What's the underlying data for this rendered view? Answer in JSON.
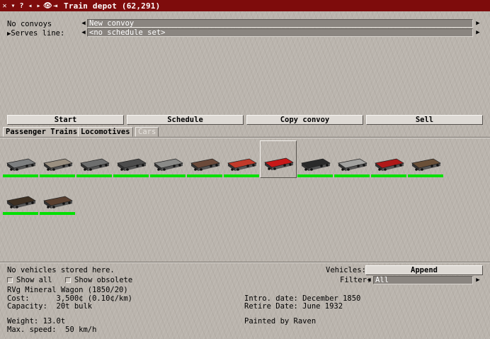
{
  "window": {
    "title": "Train depot (62,291)"
  },
  "convoy": {
    "no_convoys_label": "No convoys",
    "name_value": "New convoy",
    "serves_line_label": "Serves line:",
    "schedule_value": "<no schedule set>"
  },
  "actions": {
    "start": "Start",
    "schedule": "Schedule",
    "copy_convoy": "Copy convoy",
    "sell": "Sell"
  },
  "tabs": [
    {
      "label": "Passenger Trains",
      "active": false
    },
    {
      "label": "Locomotives",
      "active": false
    },
    {
      "label": "Cars",
      "active": true
    }
  ],
  "vehicles": [
    {
      "name": "open-wagon-grey",
      "color": "#7d7f80"
    },
    {
      "name": "flat-wagon-tan",
      "color": "#9a8f80"
    },
    {
      "name": "tank-wagon-grey",
      "color": "#6d6e6e"
    },
    {
      "name": "flat-wagon-dark",
      "color": "#4c4c4c"
    },
    {
      "name": "flat-wagon-grey",
      "color": "#8a8a88"
    },
    {
      "name": "covered-wagon-brown",
      "color": "#6b4a3a"
    },
    {
      "name": "box-wagon-red",
      "color": "#c23a2a"
    },
    {
      "name": "mineral-wagon-red",
      "color": "#c81818"
    },
    {
      "name": "tank-wagon-red-black",
      "color": "#2a2a2a"
    },
    {
      "name": "cage-wagon-grey",
      "color": "#a2a2a0"
    },
    {
      "name": "crane-wagon-red",
      "color": "#b01818"
    },
    {
      "name": "log-wagon-brown",
      "color": "#6a5038"
    },
    {
      "name": "log-wagon-dark",
      "color": "#3e3022"
    },
    {
      "name": "log-wagon-brown-2",
      "color": "#5a4030"
    }
  ],
  "depot": {
    "empty_text": "No vehicles stored here.",
    "show_all": "Show all",
    "show_obsolete": "Show obsolete",
    "vehicles_label": "Vehicles:",
    "append_label": "Append",
    "filter_label": "Filter:",
    "filter_value": "All"
  },
  "info": {
    "name": "RVg Mineral Wagon (1850/20)",
    "cost": "Cost:      3,500¢ (0.10¢/km)",
    "capacity": "Capacity:  20t bulk",
    "weight": "Weight: 13.0t",
    "max_speed": "Max. speed:  50 km/h",
    "intro_date": "Intro. date: December 1850",
    "retire_date": "Retire Date: June 1932",
    "painted_by": "Painted by Raven"
  }
}
